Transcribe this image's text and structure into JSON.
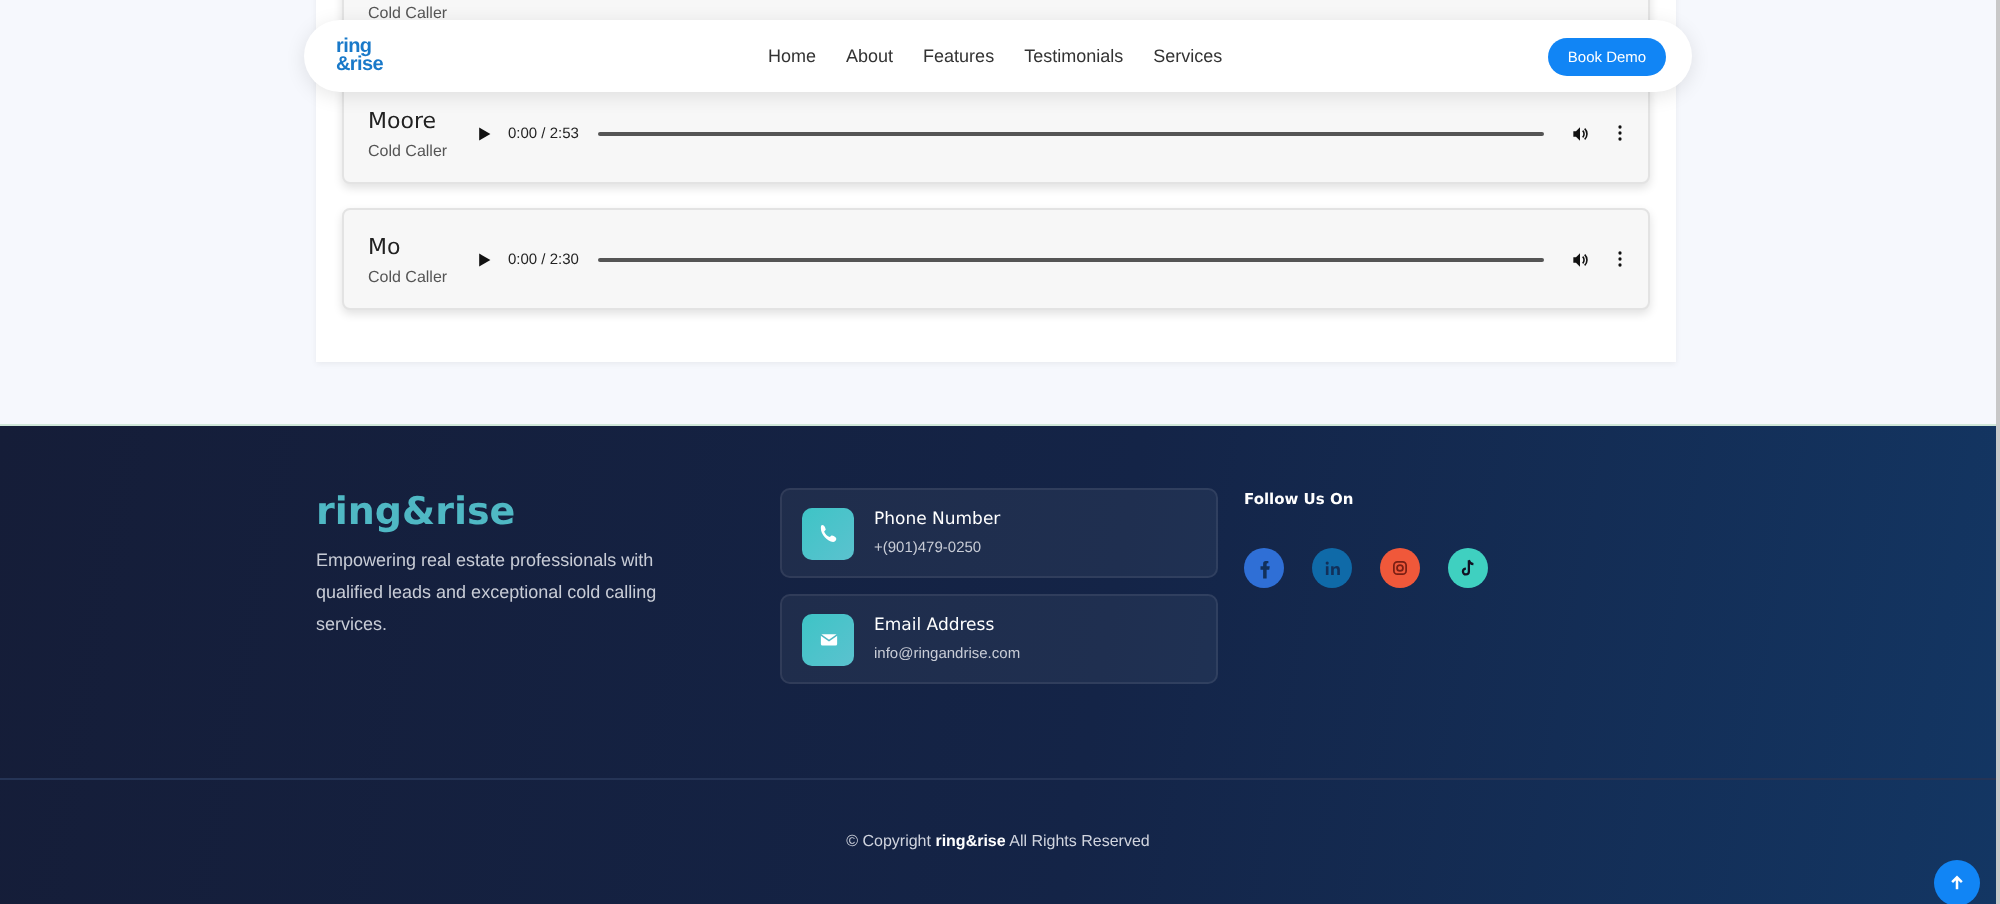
{
  "recordings": [
    {
      "role": "Cold Caller"
    },
    {
      "name": "Moore",
      "role": "Cold Caller",
      "time": "0:00 / 2:53"
    },
    {
      "name": "Mo",
      "role": "Cold Caller",
      "time": "0:00 / 2:30"
    }
  ],
  "navbar": {
    "logo": [
      "ring",
      "&rise"
    ],
    "links": [
      "Home",
      "About",
      "Features",
      "Testimonials",
      "Services"
    ],
    "cta": "Book Demo"
  },
  "footer": {
    "brand": "ring&rise",
    "description": "Empowering real estate professionals with qualified leads and exceptional cold calling services.",
    "contacts": [
      {
        "kind": "phone",
        "title": "Phone Number",
        "value": "+(901)479-0250"
      },
      {
        "kind": "email",
        "title": "Email Address",
        "value": "info@ringandrise.com"
      }
    ],
    "follow_title": "Follow Us On",
    "socials": [
      {
        "kind": "facebook",
        "color": "#2f6fd6"
      },
      {
        "kind": "linkedin",
        "color": "#0f6aa8"
      },
      {
        "kind": "instagram",
        "color": "#f0583a"
      },
      {
        "kind": "tiktok",
        "color": "#3fd0c0"
      }
    ],
    "copyright": "© Copyright **ring&rise** All Rights Reserved"
  }
}
